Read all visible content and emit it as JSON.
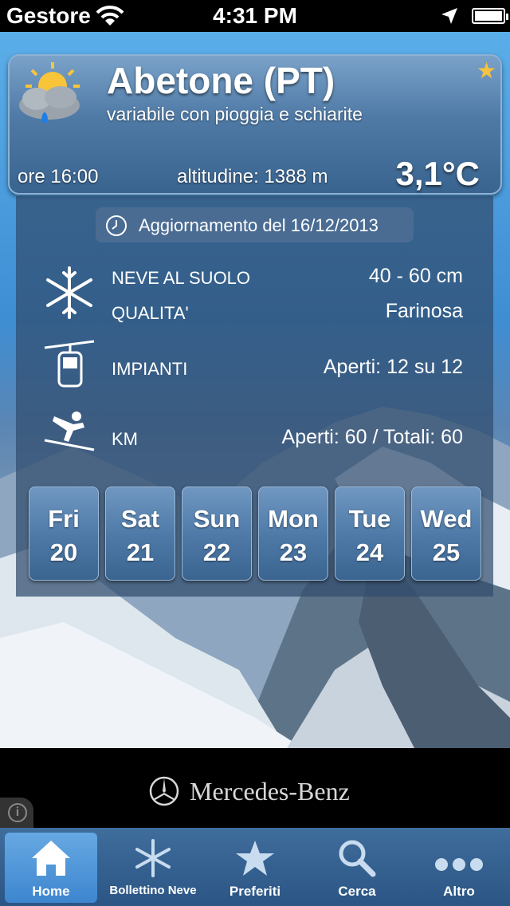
{
  "status_bar": {
    "carrier": "Gestore",
    "time": "4:31 PM"
  },
  "header": {
    "title": "Abetone (PT)",
    "subtitle": "variabile con pioggia e schiarite",
    "time_label": "ore 16:00",
    "altitude_label": "altitudine: 1388 m",
    "temperature": "3,1°C"
  },
  "update": {
    "text": "Aggiornamento del 16/12/2013"
  },
  "snow": {
    "ground_label": "NEVE AL SUOLO",
    "ground_value": "40 - 60 cm",
    "quality_label": "QUALITA'",
    "quality_value": "Farinosa"
  },
  "lifts": {
    "label": "IMPIANTI",
    "value": "Aperti: 12 su 12"
  },
  "slopes": {
    "label": "KM",
    "value": "Aperti: 60 / Totali: 60"
  },
  "days": [
    {
      "name": "Fri",
      "num": "20"
    },
    {
      "name": "Sat",
      "num": "21"
    },
    {
      "name": "Sun",
      "num": "22"
    },
    {
      "name": "Mon",
      "num": "23"
    },
    {
      "name": "Tue",
      "num": "24"
    },
    {
      "name": "Wed",
      "num": "25"
    }
  ],
  "ad": {
    "brand": "Mercedes-Benz"
  },
  "tabs": [
    {
      "label": "Home",
      "icon": "home-icon",
      "active": true
    },
    {
      "label": "Bollettino Neve",
      "icon": "snowflake-icon",
      "active": false
    },
    {
      "label": "Preferiti",
      "icon": "star-icon",
      "active": false
    },
    {
      "label": "Cerca",
      "icon": "search-icon",
      "active": false
    },
    {
      "label": "Altro",
      "icon": "more-icon",
      "active": false
    }
  ],
  "colors": {
    "accent": "#3d86cf",
    "star": "#f6c23e",
    "tab_bar": "#2b5584"
  }
}
